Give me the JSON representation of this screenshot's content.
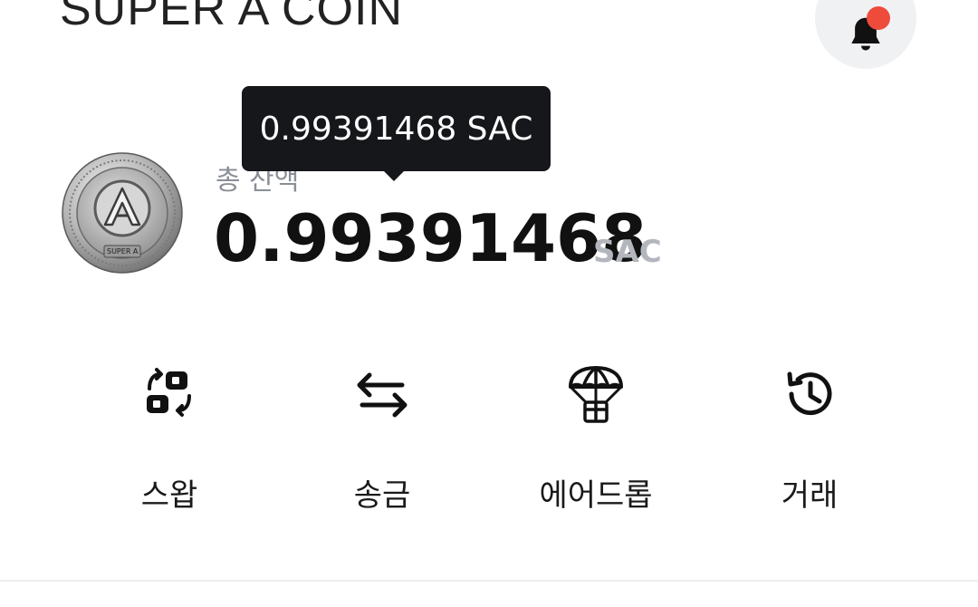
{
  "header": {
    "brand_title": "SUPER A COIN",
    "notification_icon": "bell-icon",
    "notification_dot_color": "#ee4b3b"
  },
  "coin": {
    "logo_text": "SUPER A",
    "logo_letter": "A"
  },
  "balance": {
    "label": "총 잔액",
    "amount": "0.99391468",
    "unit": "SAC",
    "tooltip": "0.99391468 SAC"
  },
  "actions": [
    {
      "label": "스왑",
      "icon": "swap-icon"
    },
    {
      "label": "송금",
      "icon": "transfer-arrows-icon"
    },
    {
      "label": "에어드롭",
      "icon": "parachute-gift-icon"
    },
    {
      "label": "거래",
      "icon": "history-icon"
    }
  ]
}
